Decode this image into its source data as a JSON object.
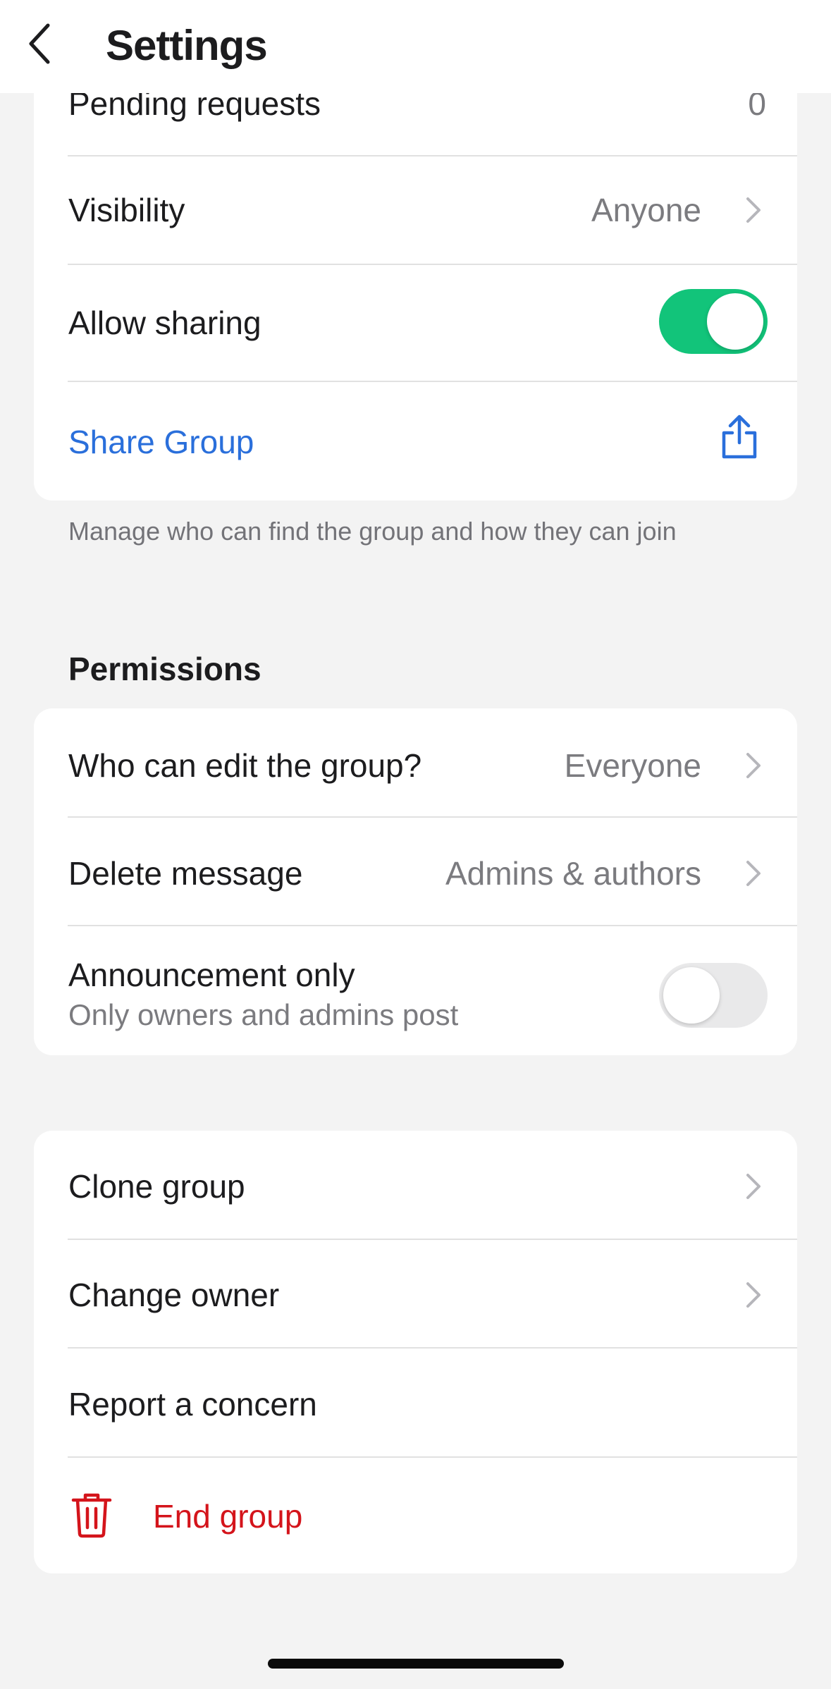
{
  "header": {
    "title": "Settings",
    "back_icon": "chevron-left-icon"
  },
  "access": {
    "pending_requests": {
      "label": "Pending requests",
      "value": "0"
    },
    "visibility": {
      "label": "Visibility",
      "value": "Anyone"
    },
    "allow_sharing": {
      "label": "Allow sharing",
      "enabled": true
    },
    "share_group": {
      "label": "Share Group",
      "icon": "share-icon"
    },
    "footnote": "Manage who can find the group and how they can join"
  },
  "permissions": {
    "title": "Permissions",
    "who_can_edit": {
      "label": "Who can edit the group?",
      "value": "Everyone"
    },
    "delete_message": {
      "label": "Delete message",
      "value": "Admins & authors"
    },
    "announcement_only": {
      "label": "Announcement only",
      "sublabel": "Only owners and admins post",
      "enabled": false
    }
  },
  "actions": {
    "clone_group": {
      "label": "Clone group"
    },
    "change_owner": {
      "label": "Change owner"
    },
    "report_concern": {
      "label": "Report a concern"
    },
    "end_group": {
      "label": "End group",
      "icon": "trash-icon"
    }
  },
  "colors": {
    "accent_blue": "#2a6fdb",
    "toggle_on": "#12c47a",
    "destructive_red": "#d4141b",
    "background": "#f3f3f3"
  }
}
